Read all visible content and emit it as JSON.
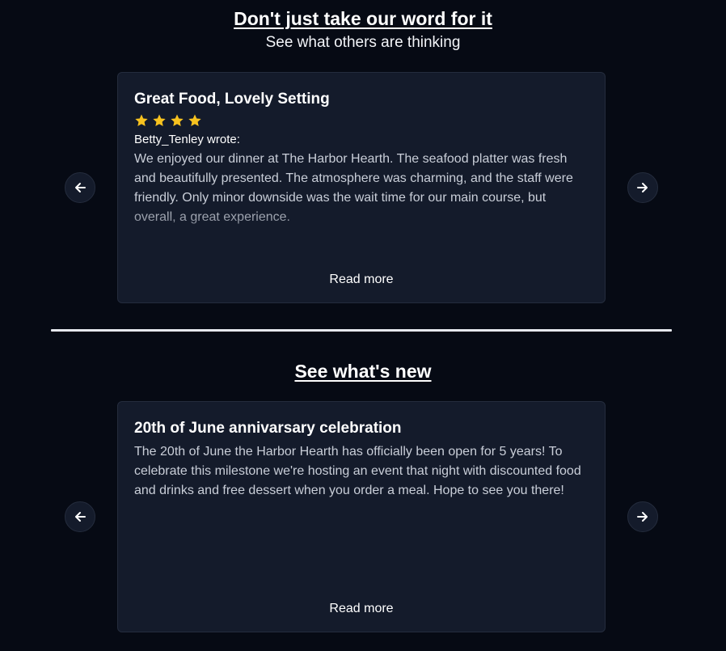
{
  "reviews_section": {
    "title": "Don't just take our word for it",
    "subtitle": "See what others are thinking",
    "card": {
      "title": "Great Food, Lovely Setting",
      "rating": 4,
      "author": "Betty_Tenley wrote:",
      "body": "We enjoyed our dinner at The Harbor Hearth. The seafood platter was fresh and beautifully presented. The atmosphere was charming, and the staff were friendly. Only minor downside was the wait time for our main course, but overall, a great experience.",
      "read_more": "Read more"
    },
    "prev_icon": "arrow-left-icon",
    "next_icon": "arrow-right-icon"
  },
  "news_section": {
    "title": "See what's new",
    "card": {
      "title": "20th of June annivarsary celebration",
      "body": "The 20th of June the Harbor Hearth has officially been open for 5 years! To celebrate this milestone we're hosting an event that night with discounted food and drinks and free dessert when you order a meal. Hope to see you there!",
      "read_more": "Read more"
    },
    "prev_icon": "arrow-left-icon",
    "next_icon": "arrow-right-icon"
  },
  "colors": {
    "background": "#060a14",
    "card": "#141b2b",
    "star": "#f7c21f",
    "text_muted": "#c9ced8"
  }
}
